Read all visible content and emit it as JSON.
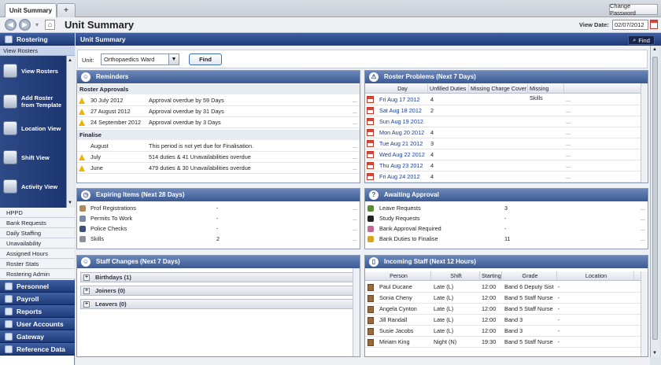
{
  "tabs": {
    "active": "Unit Summary",
    "add": "+"
  },
  "change_password": "Change Password",
  "address": {
    "title": "Unit Summary",
    "view_date_label": "View Date:",
    "view_date": "02/07/2012"
  },
  "sidebar": {
    "rostering": "Rostering",
    "view_rosters_link": "View Rosters",
    "big_items": [
      "View Rosters",
      "Add Roster from Template",
      "Location View",
      "Shift View",
      "Activity View"
    ],
    "links": [
      "HPPD",
      "Bank Requests",
      "Daily Staffing",
      "Unavailability",
      "Assigned Hours",
      "Roster Stats",
      "Rostering Admin"
    ],
    "sections": [
      "Personnel",
      "Payroll",
      "Reports",
      "User Accounts",
      "Gateway",
      "Reference Data"
    ]
  },
  "main": {
    "header": "Unit Summary",
    "find_top": "Find"
  },
  "unit": {
    "label": "Unit:",
    "value": "Orthopaedics Ward",
    "find": "Find"
  },
  "reminders": {
    "title": "Reminders",
    "approvals_title": "Roster Approvals",
    "approvals": [
      {
        "date": "30 July 2012",
        "text": "Approval overdue by 59 Days",
        "more": "..."
      },
      {
        "date": "27 August 2012",
        "text": "Approval overdue by 31 Days",
        "more": "..."
      },
      {
        "date": "24 September 2012",
        "text": "Approval overdue by 3 Days",
        "more": "..."
      }
    ],
    "finalise_title": "Finalise",
    "finalise": [
      {
        "month": "August",
        "text": "This period is not yet due for Finalisation.",
        "more": "..."
      },
      {
        "month": "July",
        "text": "514 duties & 41 Unavailabilities overdue",
        "more": "..."
      },
      {
        "month": "June",
        "text": "479 duties & 30 Unavailabilities overdue",
        "more": "..."
      }
    ]
  },
  "problems": {
    "title": "Roster Problems (Next 7 Days)",
    "cols": [
      "Day",
      "Unfilled Duties",
      "Missing Charge Cover",
      "Missing Skills"
    ],
    "rows": [
      {
        "day": "Fri Aug 17 2012",
        "unfilled": "4",
        "charge": "",
        "skills": "",
        "more": "..."
      },
      {
        "day": "Sat Aug 18 2012",
        "unfilled": "2",
        "charge": "",
        "skills": "",
        "more": "..."
      },
      {
        "day": "Sun Aug 19 2012",
        "unfilled": "",
        "charge": "",
        "skills": "",
        "more": "..."
      },
      {
        "day": "Mon Aug 20 2012",
        "unfilled": "4",
        "charge": "",
        "skills": "",
        "more": "..."
      },
      {
        "day": "Tue Aug 21 2012",
        "unfilled": "3",
        "charge": "",
        "skills": "",
        "more": "..."
      },
      {
        "day": "Wed Aug 22 2012",
        "unfilled": "4",
        "charge": "",
        "skills": "",
        "more": "..."
      },
      {
        "day": "Thu Aug 23 2012",
        "unfilled": "4",
        "charge": "",
        "skills": "",
        "more": "..."
      },
      {
        "day": "Fri Aug 24 2012",
        "unfilled": "4",
        "charge": "",
        "skills": "",
        "more": "..."
      }
    ]
  },
  "expiring": {
    "title": "Expiring Items (Next 28 Days)",
    "rows": [
      {
        "name": "Prof Registrations",
        "value": "-",
        "more": "..."
      },
      {
        "name": "Permits To Work",
        "value": "-",
        "more": "..."
      },
      {
        "name": "Police Checks",
        "value": "-",
        "more": "..."
      },
      {
        "name": "Skills",
        "value": "2",
        "more": "..."
      }
    ]
  },
  "awaiting": {
    "title": "Awaiting Approval",
    "rows": [
      {
        "name": "Leave Requests",
        "value": "3",
        "more": "..."
      },
      {
        "name": "Study Requests",
        "value": "-",
        "more": "..."
      },
      {
        "name": "Bank Approval Required",
        "value": "-",
        "more": "..."
      },
      {
        "name": "Bank Duties to Finalise",
        "value": "11",
        "more": "..."
      }
    ]
  },
  "staff_changes": {
    "title": "Staff Changes (Next 7 Days)",
    "items": [
      "Birthdays (1)",
      "Joiners (0)",
      "Leavers (0)"
    ]
  },
  "incoming": {
    "title": "Incoming Staff (Next 12 Hours)",
    "cols": [
      "Person",
      "Shift",
      "Starting",
      "Grade",
      "Location"
    ],
    "rows": [
      {
        "person": "Paul Ducane",
        "shift": "Late (L)",
        "starting": "12:00",
        "grade": "Band 6 Deputy Sist",
        "location": "-"
      },
      {
        "person": "Sonia Cheny",
        "shift": "Late (L)",
        "starting": "12:00",
        "grade": "Band 5 Staff Nurse",
        "location": "-"
      },
      {
        "person": "Angela Cynton",
        "shift": "Late (L)",
        "starting": "12:00",
        "grade": "Band 5 Staff Nurse",
        "location": "-"
      },
      {
        "person": "Jill Randall",
        "shift": "Late (L)",
        "starting": "12:00",
        "grade": "Band 3",
        "location": "-"
      },
      {
        "person": "Susie Jacobs",
        "shift": "Late (L)",
        "starting": "12:00",
        "grade": "Band 3",
        "location": "-"
      },
      {
        "person": "Miriam King",
        "shift": "Night (N)",
        "starting": "19:30",
        "grade": "Band 5 Staff Nurse",
        "location": "-"
      }
    ]
  }
}
